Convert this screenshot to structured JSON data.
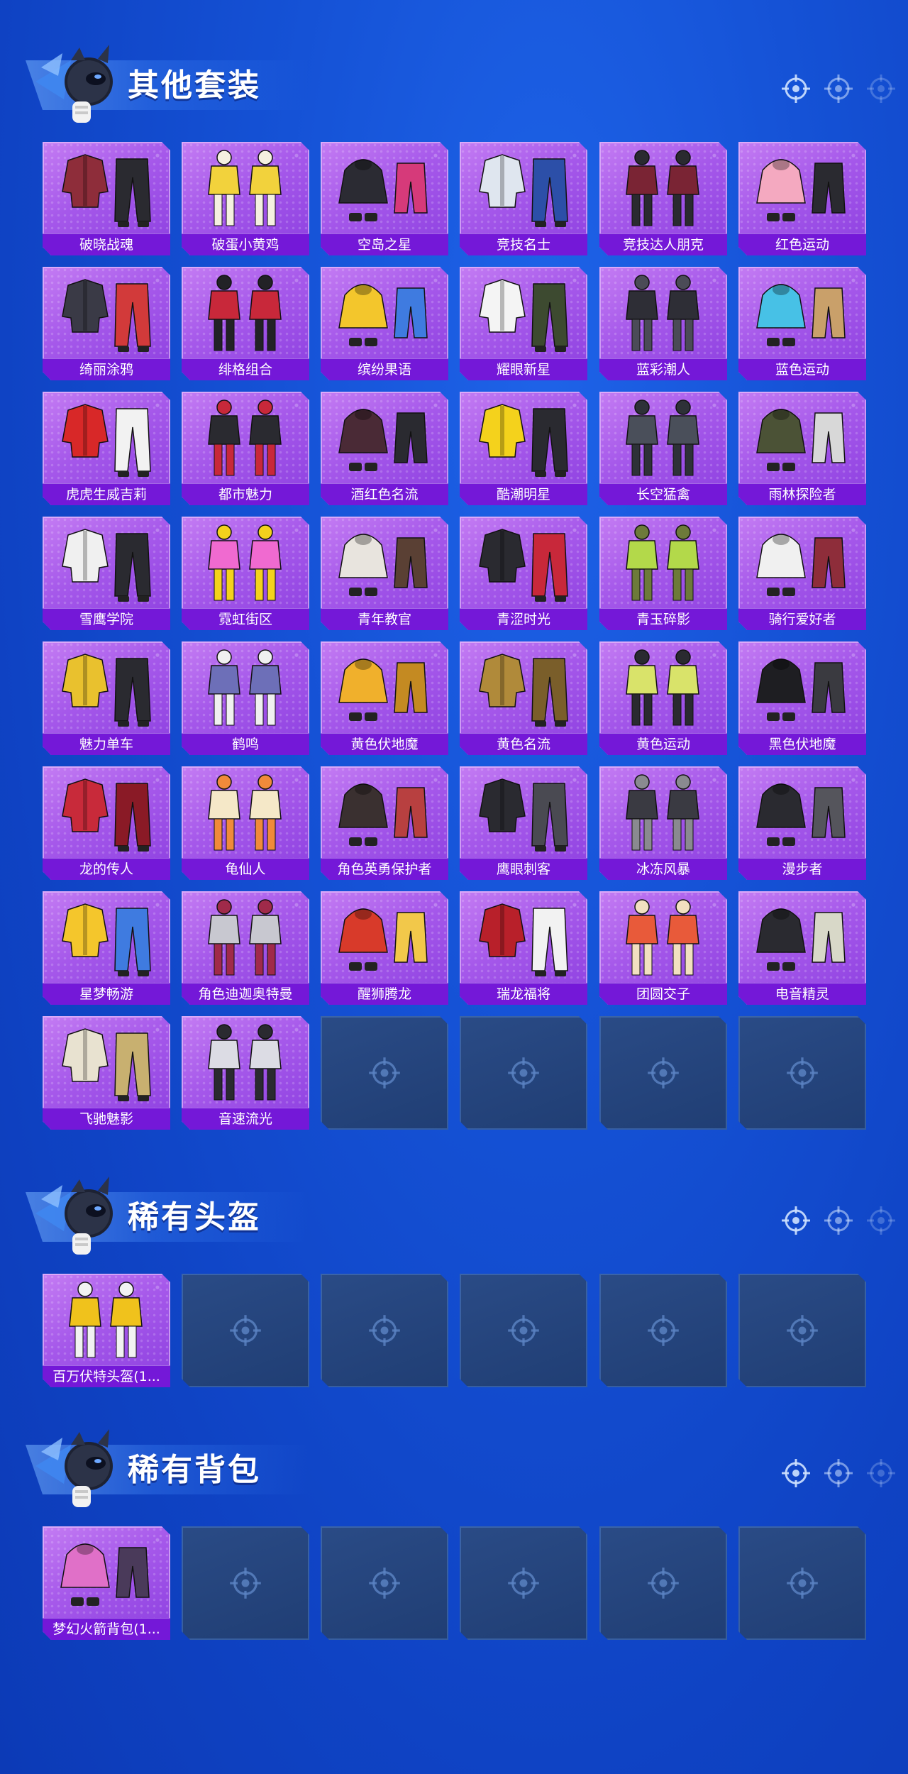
{
  "sections": [
    {
      "title": "其他套装",
      "items": [
        {
          "label": "破晓战魂",
          "c1": "#8e2d3a",
          "c2": "#2a2a30"
        },
        {
          "label": "破蛋小黄鸡",
          "c1": "#f2d23c",
          "c2": "#f5f0e0"
        },
        {
          "label": "空岛之星",
          "c1": "#2b2b33",
          "c2": "#d63a7a"
        },
        {
          "label": "竞技名士",
          "c1": "#dfe6ef",
          "c2": "#2c4fa8"
        },
        {
          "label": "竞技达人朋克",
          "c1": "#7a2434",
          "c2": "#2a2a30"
        },
        {
          "label": "红色运动",
          "c1": "#f4a9c0",
          "c2": "#2a2a30"
        },
        {
          "label": "绮丽涂鸦",
          "c1": "#3a3a46",
          "c2": "#d23a3a"
        },
        {
          "label": "绯格组合",
          "c1": "#c8283a",
          "c2": "#222226"
        },
        {
          "label": "缤纷果语",
          "c1": "#f3c62c",
          "c2": "#3f7be0"
        },
        {
          "label": "耀眼新星",
          "c1": "#f4f4f4",
          "c2": "#3d4a30"
        },
        {
          "label": "蓝彩潮人",
          "c1": "#2e2e36",
          "c2": "#4b4b57"
        },
        {
          "label": "蓝色运动",
          "c1": "#47c1e6",
          "c2": "#c9a06a"
        },
        {
          "label": "虎虎生威吉莉",
          "c1": "#d82828",
          "c2": "#f2f2f2"
        },
        {
          "label": "都市魅力",
          "c1": "#2a2a30",
          "c2": "#c8283a"
        },
        {
          "label": "酒红色名流",
          "c1": "#4a2a36",
          "c2": "#2a2a30"
        },
        {
          "label": "酷潮明星",
          "c1": "#f4d21c",
          "c2": "#2a2a30"
        },
        {
          "label": "长空猛禽",
          "c1": "#4a4f5a",
          "c2": "#2e3138"
        },
        {
          "label": "雨林探险者",
          "c1": "#4b5236",
          "c2": "#d8d8d8"
        },
        {
          "label": "雪鹰学院",
          "c1": "#f0f0f0",
          "c2": "#2a2a30"
        },
        {
          "label": "霓虹街区",
          "c1": "#f06ad0",
          "c2": "#f4d21c"
        },
        {
          "label": "青年教官",
          "c1": "#e8e4de",
          "c2": "#5a4034"
        },
        {
          "label": "青涩时光",
          "c1": "#2a2a30",
          "c2": "#c8283a"
        },
        {
          "label": "青玉碎影",
          "c1": "#b3d94a",
          "c2": "#6d7a3a"
        },
        {
          "label": "骑行爱好者",
          "c1": "#f0f0f0",
          "c2": "#8e2d3a"
        },
        {
          "label": "魅力单车",
          "c1": "#e9c12e",
          "c2": "#2a2a30"
        },
        {
          "label": "鹤鸣",
          "c1": "#6d6fb8",
          "c2": "#f0f0f0"
        },
        {
          "label": "黄色伏地魔",
          "c1": "#f0b02c",
          "c2": "#c48a22"
        },
        {
          "label": "黄色名流",
          "c1": "#b08a3a",
          "c2": "#7a5e2a"
        },
        {
          "label": "黄色运动",
          "c1": "#d9e36a",
          "c2": "#2a2a30"
        },
        {
          "label": "黑色伏地魔",
          "c1": "#1e1e22",
          "c2": "#3a3a40"
        },
        {
          "label": "龙的传人",
          "c1": "#c82a3a",
          "c2": "#8a1a26"
        },
        {
          "label": "龟仙人",
          "c1": "#f5e8c8",
          "c2": "#f08a3a"
        },
        {
          "label": "角色英勇保护者",
          "c1": "#3a3030",
          "c2": "#b84040"
        },
        {
          "label": "鹰眼刺客",
          "c1": "#2a2a30",
          "c2": "#4a4a52"
        },
        {
          "label": "冰冻风暴",
          "c1": "#3a3a42",
          "c2": "#8a8a90"
        },
        {
          "label": "漫步者",
          "c1": "#2a2a30",
          "c2": "#55555c"
        },
        {
          "label": "星梦畅游",
          "c1": "#f4c62c",
          "c2": "#3f7be0"
        },
        {
          "label": "角色迪迦奥特曼",
          "c1": "#c8c8d0",
          "c2": "#a02a4a"
        },
        {
          "label": "醒狮腾龙",
          "c1": "#d83a2a",
          "c2": "#f2c84a"
        },
        {
          "label": "瑞龙福将",
          "c1": "#b8202a",
          "c2": "#f2f2f2"
        },
        {
          "label": "团圆交子",
          "c1": "#e85a3a",
          "c2": "#f2e0c0"
        },
        {
          "label": "电音精灵",
          "c1": "#2a2a30",
          "c2": "#d8d8c8"
        },
        {
          "label": "飞驰魅影",
          "c1": "#e8e2d0",
          "c2": "#c8b070"
        },
        {
          "label": "音速流光",
          "c1": "#dcdce4",
          "c2": "#2a2a30"
        }
      ]
    },
    {
      "title": "稀有头盔",
      "items": [
        {
          "label": "百万伏特头盔(1...",
          "c1": "#f0c21c",
          "c2": "#f2f2f2"
        }
      ]
    },
    {
      "title": "稀有背包",
      "items": [
        {
          "label": "梦幻火箭背包(1...",
          "c1": "#e070c8",
          "c2": "#4a3a5a"
        }
      ]
    }
  ]
}
